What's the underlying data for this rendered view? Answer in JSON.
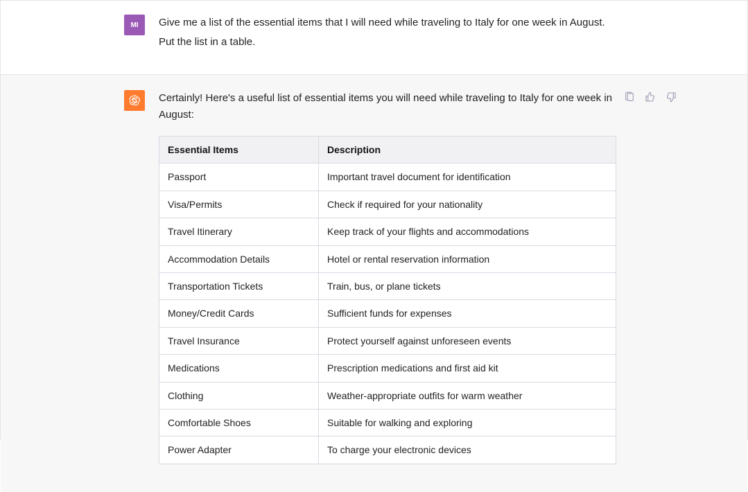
{
  "user": {
    "avatar_text": "MI",
    "message_line1": "Give me a list of the essential items that I will need while traveling to Italy for one week in August.",
    "message_line2": "Put the list in a table."
  },
  "assistant": {
    "intro": "Certainly! Here's a useful list of essential items you will need while traveling to Italy for one week in August:",
    "table": {
      "headers": [
        "Essential Items",
        "Description"
      ],
      "rows": [
        [
          "Passport",
          "Important travel document for identification"
        ],
        [
          "Visa/Permits",
          "Check if required for your nationality"
        ],
        [
          "Travel Itinerary",
          "Keep track of your flights and accommodations"
        ],
        [
          "Accommodation Details",
          "Hotel or rental reservation information"
        ],
        [
          "Transportation Tickets",
          "Train, bus, or plane tickets"
        ],
        [
          "Money/Credit Cards",
          "Sufficient funds for expenses"
        ],
        [
          "Travel Insurance",
          "Protect yourself against unforeseen events"
        ],
        [
          "Medications",
          "Prescription medications and first aid kit"
        ],
        [
          "Clothing",
          "Weather-appropriate outfits for warm weather"
        ],
        [
          "Comfortable Shoes",
          "Suitable for walking and exploring"
        ],
        [
          "Power Adapter",
          "To charge your electronic devices"
        ]
      ]
    }
  },
  "actions": {
    "copy": "copy",
    "thumbs_up": "thumbs-up",
    "thumbs_down": "thumbs-down"
  }
}
